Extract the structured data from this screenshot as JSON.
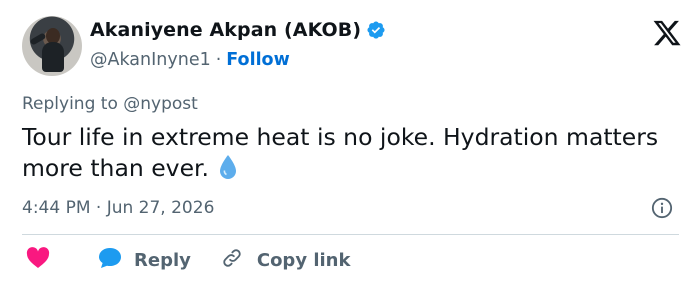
{
  "author": {
    "name": "Akaniyene Akpan (AKOB)",
    "handle": "@AkanInyne1",
    "separator": "·",
    "follow_label": "Follow"
  },
  "icons": {
    "verified": "verified-badge-icon",
    "platform": "x-logo-icon",
    "info": "info-icon",
    "like": "heart-icon",
    "reply": "reply-bubble-icon",
    "copy": "link-icon",
    "emoji": "droplet-emoji"
  },
  "colors": {
    "accent": "#006fd6",
    "heart": "#f91880",
    "reply_bubble": "#1d9bf0",
    "muted": "#536471",
    "text": "#0f1419",
    "divider": "#cfd9de"
  },
  "tweet": {
    "replying_prefix": "Replying to",
    "replying_to": "@nypost",
    "text": "Tour life in extreme heat is no joke. Hydration matters more than ever.",
    "timestamp": "4:44 PM · Jun 27, 2026"
  },
  "actions": {
    "reply_label": "Reply",
    "copy_link_label": "Copy link"
  }
}
